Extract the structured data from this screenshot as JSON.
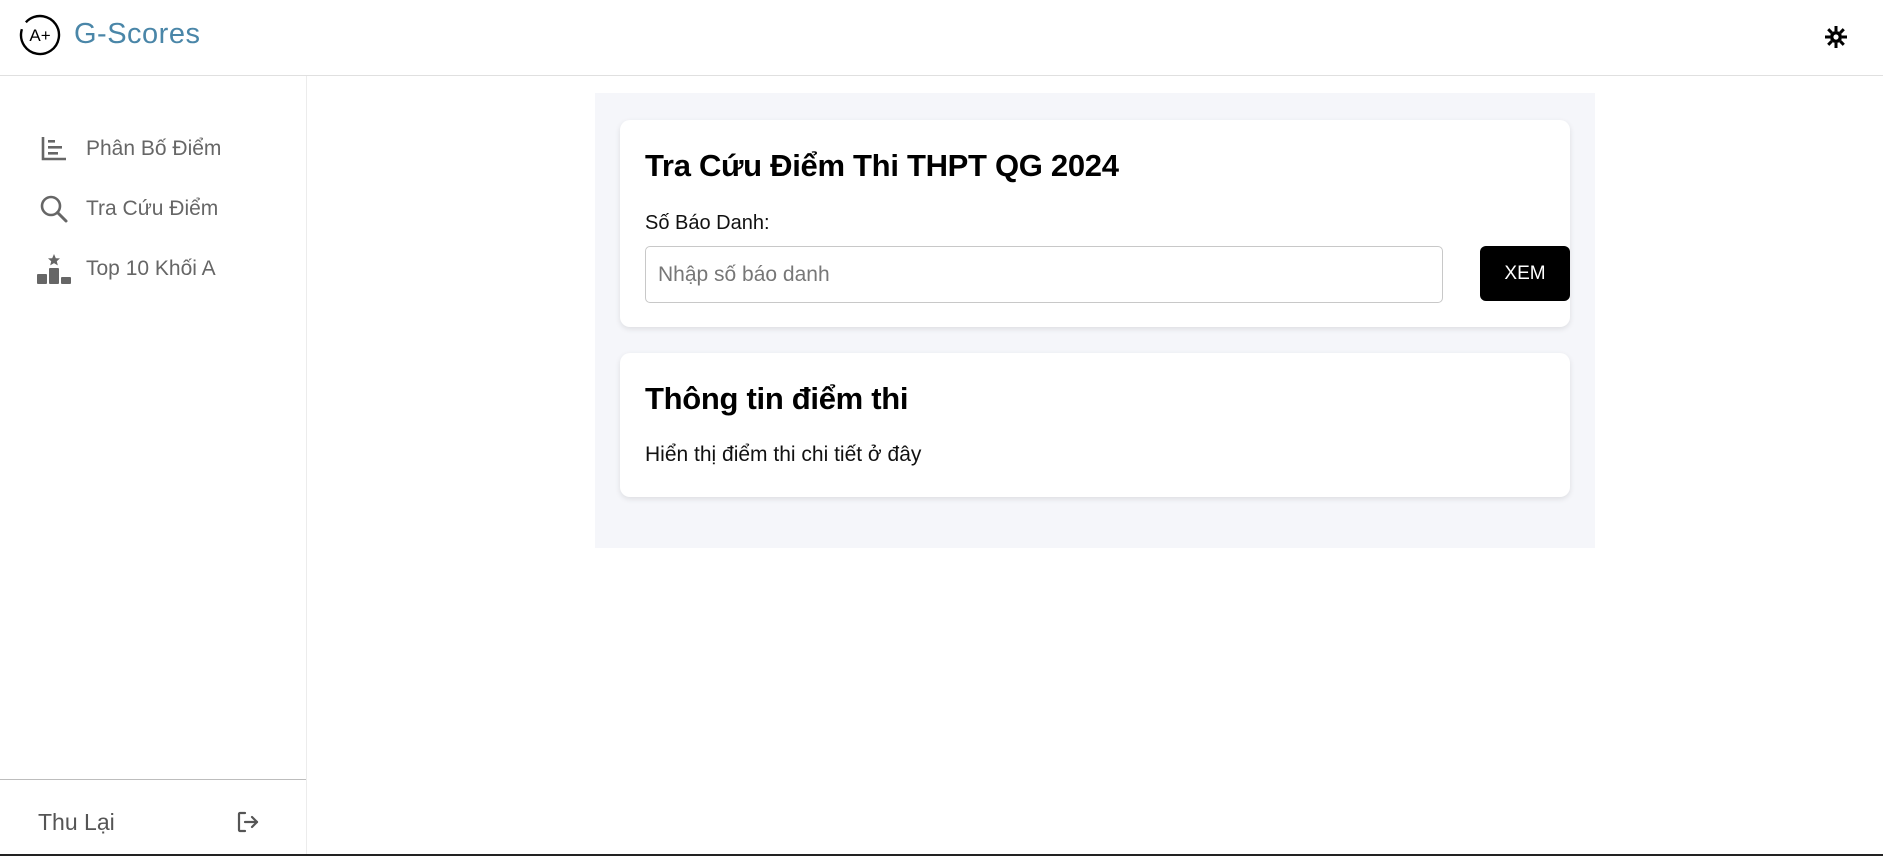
{
  "header": {
    "brand": "G-Scores",
    "logo_text": "A+",
    "theme_icon": "sun-gear-icon",
    "brand_color": "#4a86a8"
  },
  "sidebar": {
    "items": [
      {
        "label": "Phân Bố Điểm",
        "icon": "bar-chart-icon"
      },
      {
        "label": "Tra Cứu Điểm",
        "icon": "search-icon"
      },
      {
        "label": "Top 10 Khối A",
        "icon": "podium-icon"
      }
    ],
    "logout_label": "Thu Lại",
    "logout_icon": "logout-icon"
  },
  "search_card": {
    "title": "Tra Cứu Điểm Thi THPT QG 2024",
    "field_label": "Số Báo Danh:",
    "input_value": "",
    "input_placeholder": "Nhập số báo danh",
    "submit_label": "XEM"
  },
  "result_card": {
    "title": "Thông tin điểm thi",
    "body": "Hiển thị điểm thi chi tiết ở đây"
  },
  "colors": {
    "panel_bg": "#f5f6fa",
    "button_bg": "#000000",
    "nav_text": "#666666"
  }
}
